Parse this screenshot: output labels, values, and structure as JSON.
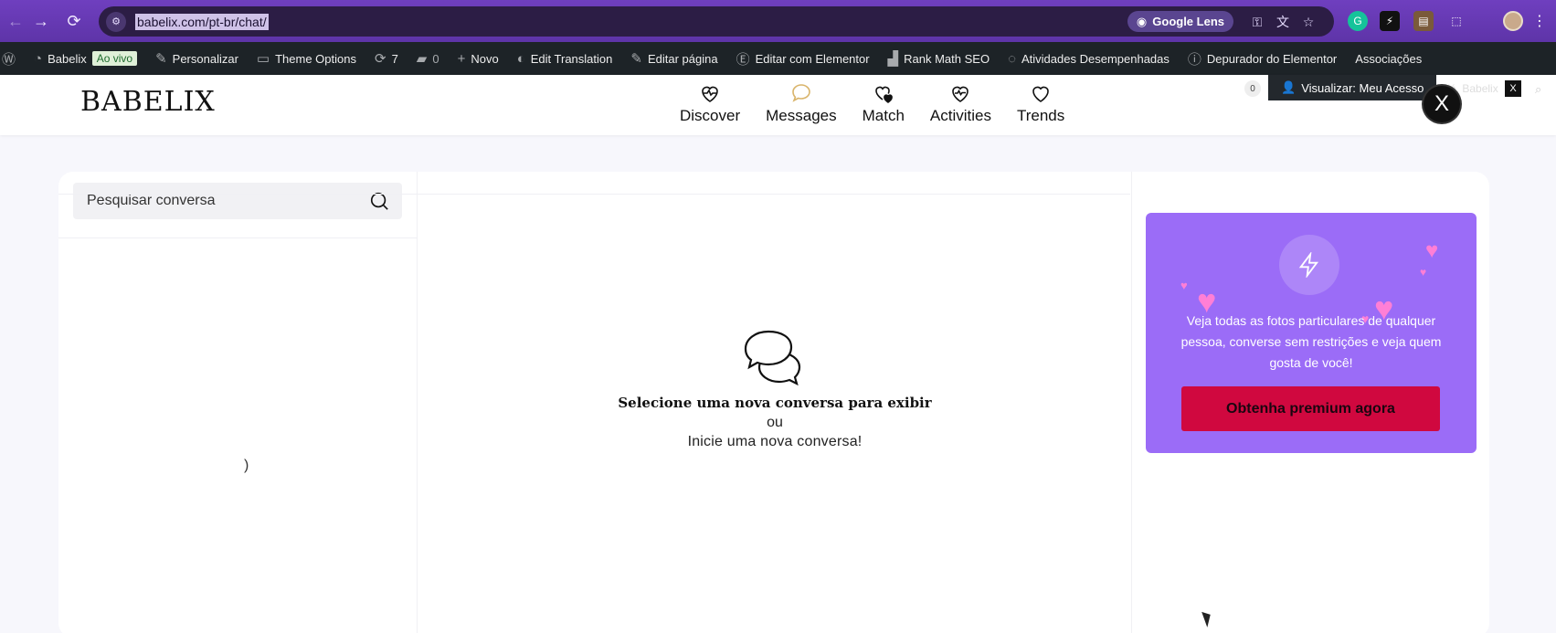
{
  "browser": {
    "url": "babelix.com/pt-br/chat/",
    "lens_label": "Google Lens",
    "back_icon": "arrow-left-icon",
    "forward_icon": "arrow-right-icon",
    "reload_icon": "reload-icon"
  },
  "admin_bar": {
    "items": [
      {
        "label": "Babelix"
      },
      {
        "label": "Ao vivo"
      },
      {
        "label": "Personalizar"
      },
      {
        "label": "Theme Options"
      },
      {
        "label": "7"
      },
      {
        "label": "0"
      },
      {
        "label": "Novo"
      },
      {
        "label": "Edit Translation"
      },
      {
        "label": "Editar página"
      },
      {
        "label": "Editar com Elementor"
      },
      {
        "label": "Rank Math SEO"
      },
      {
        "label": "Atividades Desempenhadas"
      },
      {
        "label": "Depurador do Elementor"
      },
      {
        "label": "Associações"
      }
    ]
  },
  "header": {
    "logo": "BABELIX",
    "nav": [
      {
        "label": "Discover"
      },
      {
        "label": "Messages"
      },
      {
        "label": "Match"
      },
      {
        "label": "Activities"
      },
      {
        "label": "Trends"
      }
    ],
    "notif_count": "0",
    "view_access": "Visualizar: Meu Acesso",
    "ola_user": "Olá, Babelix",
    "avatar_letter": "X",
    "x_mini": "X"
  },
  "chat": {
    "search_placeholder": "Pesquisar conversa",
    "loader": ")",
    "empty_title": "Selecione uma nova conversa para exibir",
    "empty_or": "ou",
    "empty_start": "Inicie uma nova conversa!"
  },
  "premium": {
    "text": "Veja todas as fotos particulares de qualquer pessoa, converse sem restrições e veja quem gosta de você!",
    "button": "Obtenha premium agora",
    "accent": "#9b6cf7",
    "button_color": "#d0083f"
  }
}
